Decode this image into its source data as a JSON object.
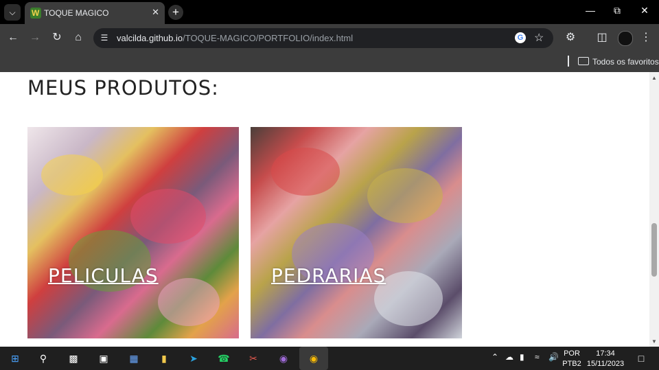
{
  "browser": {
    "tab": {
      "title": "TOQUE MAGICO"
    },
    "address": {
      "host": "valcilda.github.io",
      "path": "/TOQUE-MAGICO/PORTFOLIO/index.html"
    },
    "bookmarks": {
      "all_label": "Todos os favoritos"
    }
  },
  "page": {
    "heading": "MEUS PRODUTOS:",
    "cards": [
      {
        "label": "PELICULAS"
      },
      {
        "label": "PEDRARIAS"
      }
    ]
  },
  "taskbar": {
    "lang_top": "POR",
    "lang_bottom": "PTB2",
    "time": "17:34",
    "date": "15/11/2023"
  },
  "icons": [
    "tab-search-icon",
    "close-icon",
    "plus-icon",
    "minimize-icon",
    "restore-icon",
    "back-icon",
    "forward-icon",
    "reload-icon",
    "home-icon",
    "site-info-icon",
    "google-icon",
    "star-icon",
    "extensions-icon",
    "sidepanel-icon",
    "profile-avatar",
    "kebab-menu-icon",
    "folder-icon",
    "windows-start-icon",
    "search-icon",
    "terminal-icon",
    "files-icon",
    "store-icon",
    "explorer-icon",
    "telegram-icon",
    "whatsapp-icon",
    "snip-icon",
    "github-icon",
    "chrome-icon",
    "chevron-up-icon",
    "cloud-icon",
    "battery-icon",
    "wifi-icon",
    "speaker-icon",
    "notification-icon"
  ]
}
